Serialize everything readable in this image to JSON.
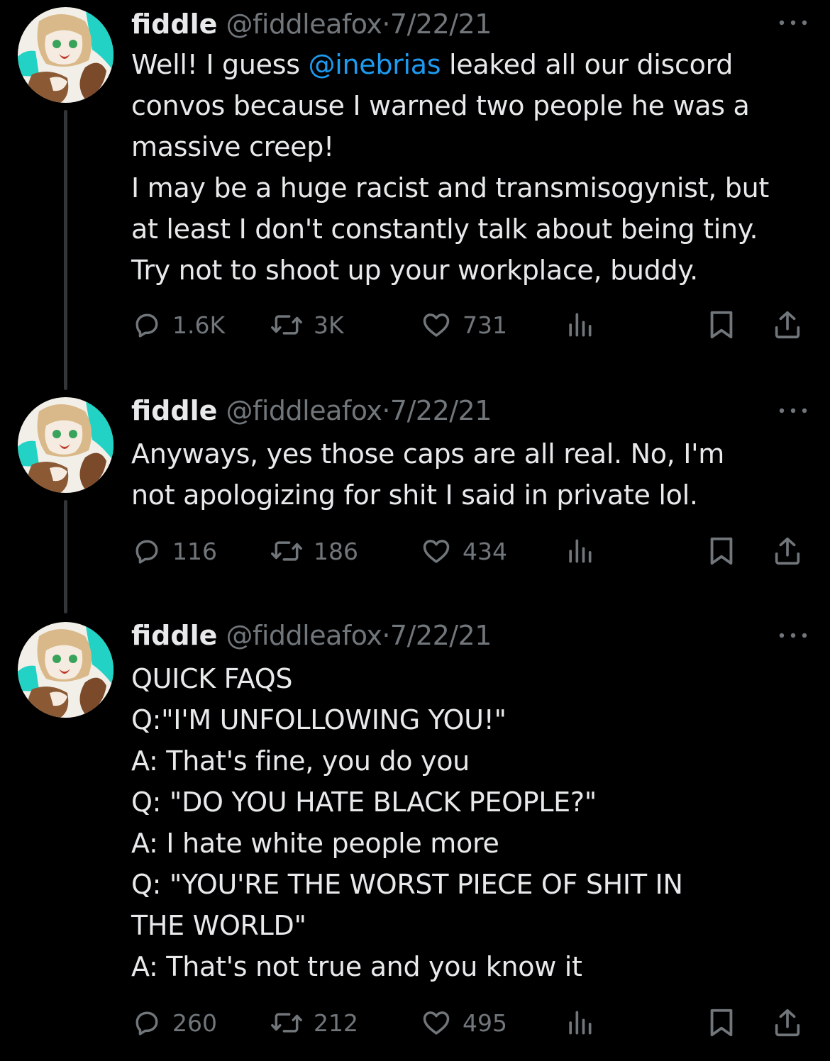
{
  "colors": {
    "background": "#000000",
    "text": "#e7e9ea",
    "muted": "#71767b",
    "mention": "#1d9bf0",
    "thread_line": "#333639"
  },
  "icons": {
    "reply": "reply-icon",
    "retweet": "retweet-icon",
    "like": "heart-icon",
    "views": "views-chart-icon",
    "bookmark": "bookmark-icon",
    "share": "share-icon",
    "more": "more-dots-icon"
  },
  "tweets": [
    {
      "name": "fiddle",
      "handle": "@fiddleafox",
      "separator": "·",
      "date": "7/22/21",
      "text_lines": [
        {
          "before": "Well! I guess ",
          "mention": "@inebrias",
          "after": " leaked all our discord"
        },
        {
          "before": "convos because I warned two people he was a"
        },
        {
          "before": "massive creep!"
        },
        {
          "before": "I may be a huge racist and transmisogynist, but"
        },
        {
          "before": "at least I don't constantly talk about being tiny."
        },
        {
          "before": "Try not to shoot up your workplace, buddy."
        }
      ],
      "replies": "1.6K",
      "retweets": "3K",
      "likes": "731"
    },
    {
      "name": "fiddle",
      "handle": "@fiddleafox",
      "separator": "·",
      "date": "7/22/21",
      "text_lines": [
        {
          "before": "Anyways, yes those caps are all real. No, I'm"
        },
        {
          "before": "not apologizing for shit I said in private lol."
        }
      ],
      "replies": "116",
      "retweets": "186",
      "likes": "434"
    },
    {
      "name": "fiddle",
      "handle": "@fiddleafox",
      "separator": "·",
      "date": "7/22/21",
      "text_lines": [
        {
          "before": "QUICK FAQS"
        },
        {
          "before": "Q:\"I'M UNFOLLOWING YOU!\""
        },
        {
          "before": "A: That's fine, you do you"
        },
        {
          "before": "Q: \"DO YOU HATE BLACK PEOPLE?\""
        },
        {
          "before": "A: I hate white people more"
        },
        {
          "before": "Q: \"YOU'RE THE WORST PIECE OF SHIT IN"
        },
        {
          "before": "THE WORLD\""
        },
        {
          "before": "A: That's not true and you know it"
        }
      ],
      "replies": "260",
      "retweets": "212",
      "likes": "495"
    }
  ]
}
